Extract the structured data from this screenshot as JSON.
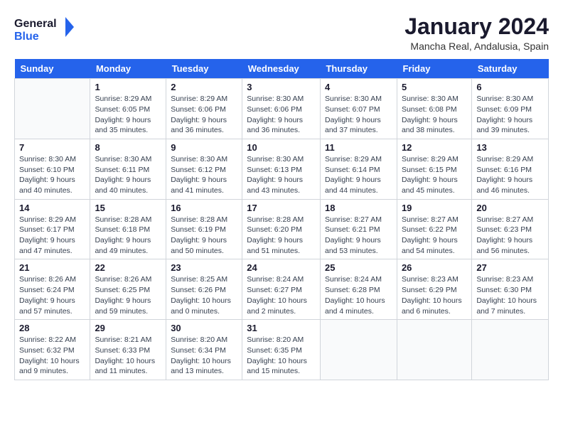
{
  "header": {
    "logo_general": "General",
    "logo_blue": "Blue",
    "month_title": "January 2024",
    "location": "Mancha Real, Andalusia, Spain"
  },
  "days_of_week": [
    "Sunday",
    "Monday",
    "Tuesday",
    "Wednesday",
    "Thursday",
    "Friday",
    "Saturday"
  ],
  "weeks": [
    [
      {
        "day": "",
        "info": ""
      },
      {
        "day": "1",
        "info": "Sunrise: 8:29 AM\nSunset: 6:05 PM\nDaylight: 9 hours\nand 35 minutes."
      },
      {
        "day": "2",
        "info": "Sunrise: 8:29 AM\nSunset: 6:06 PM\nDaylight: 9 hours\nand 36 minutes."
      },
      {
        "day": "3",
        "info": "Sunrise: 8:30 AM\nSunset: 6:06 PM\nDaylight: 9 hours\nand 36 minutes."
      },
      {
        "day": "4",
        "info": "Sunrise: 8:30 AM\nSunset: 6:07 PM\nDaylight: 9 hours\nand 37 minutes."
      },
      {
        "day": "5",
        "info": "Sunrise: 8:30 AM\nSunset: 6:08 PM\nDaylight: 9 hours\nand 38 minutes."
      },
      {
        "day": "6",
        "info": "Sunrise: 8:30 AM\nSunset: 6:09 PM\nDaylight: 9 hours\nand 39 minutes."
      }
    ],
    [
      {
        "day": "7",
        "info": "Sunrise: 8:30 AM\nSunset: 6:10 PM\nDaylight: 9 hours\nand 40 minutes."
      },
      {
        "day": "8",
        "info": "Sunrise: 8:30 AM\nSunset: 6:11 PM\nDaylight: 9 hours\nand 40 minutes."
      },
      {
        "day": "9",
        "info": "Sunrise: 8:30 AM\nSunset: 6:12 PM\nDaylight: 9 hours\nand 41 minutes."
      },
      {
        "day": "10",
        "info": "Sunrise: 8:30 AM\nSunset: 6:13 PM\nDaylight: 9 hours\nand 43 minutes."
      },
      {
        "day": "11",
        "info": "Sunrise: 8:29 AM\nSunset: 6:14 PM\nDaylight: 9 hours\nand 44 minutes."
      },
      {
        "day": "12",
        "info": "Sunrise: 8:29 AM\nSunset: 6:15 PM\nDaylight: 9 hours\nand 45 minutes."
      },
      {
        "day": "13",
        "info": "Sunrise: 8:29 AM\nSunset: 6:16 PM\nDaylight: 9 hours\nand 46 minutes."
      }
    ],
    [
      {
        "day": "14",
        "info": "Sunrise: 8:29 AM\nSunset: 6:17 PM\nDaylight: 9 hours\nand 47 minutes."
      },
      {
        "day": "15",
        "info": "Sunrise: 8:28 AM\nSunset: 6:18 PM\nDaylight: 9 hours\nand 49 minutes."
      },
      {
        "day": "16",
        "info": "Sunrise: 8:28 AM\nSunset: 6:19 PM\nDaylight: 9 hours\nand 50 minutes."
      },
      {
        "day": "17",
        "info": "Sunrise: 8:28 AM\nSunset: 6:20 PM\nDaylight: 9 hours\nand 51 minutes."
      },
      {
        "day": "18",
        "info": "Sunrise: 8:27 AM\nSunset: 6:21 PM\nDaylight: 9 hours\nand 53 minutes."
      },
      {
        "day": "19",
        "info": "Sunrise: 8:27 AM\nSunset: 6:22 PM\nDaylight: 9 hours\nand 54 minutes."
      },
      {
        "day": "20",
        "info": "Sunrise: 8:27 AM\nSunset: 6:23 PM\nDaylight: 9 hours\nand 56 minutes."
      }
    ],
    [
      {
        "day": "21",
        "info": "Sunrise: 8:26 AM\nSunset: 6:24 PM\nDaylight: 9 hours\nand 57 minutes."
      },
      {
        "day": "22",
        "info": "Sunrise: 8:26 AM\nSunset: 6:25 PM\nDaylight: 9 hours\nand 59 minutes."
      },
      {
        "day": "23",
        "info": "Sunrise: 8:25 AM\nSunset: 6:26 PM\nDaylight: 10 hours\nand 0 minutes."
      },
      {
        "day": "24",
        "info": "Sunrise: 8:24 AM\nSunset: 6:27 PM\nDaylight: 10 hours\nand 2 minutes."
      },
      {
        "day": "25",
        "info": "Sunrise: 8:24 AM\nSunset: 6:28 PM\nDaylight: 10 hours\nand 4 minutes."
      },
      {
        "day": "26",
        "info": "Sunrise: 8:23 AM\nSunset: 6:29 PM\nDaylight: 10 hours\nand 6 minutes."
      },
      {
        "day": "27",
        "info": "Sunrise: 8:23 AM\nSunset: 6:30 PM\nDaylight: 10 hours\nand 7 minutes."
      }
    ],
    [
      {
        "day": "28",
        "info": "Sunrise: 8:22 AM\nSunset: 6:32 PM\nDaylight: 10 hours\nand 9 minutes."
      },
      {
        "day": "29",
        "info": "Sunrise: 8:21 AM\nSunset: 6:33 PM\nDaylight: 10 hours\nand 11 minutes."
      },
      {
        "day": "30",
        "info": "Sunrise: 8:20 AM\nSunset: 6:34 PM\nDaylight: 10 hours\nand 13 minutes."
      },
      {
        "day": "31",
        "info": "Sunrise: 8:20 AM\nSunset: 6:35 PM\nDaylight: 10 hours\nand 15 minutes."
      },
      {
        "day": "",
        "info": ""
      },
      {
        "day": "",
        "info": ""
      },
      {
        "day": "",
        "info": ""
      }
    ]
  ]
}
